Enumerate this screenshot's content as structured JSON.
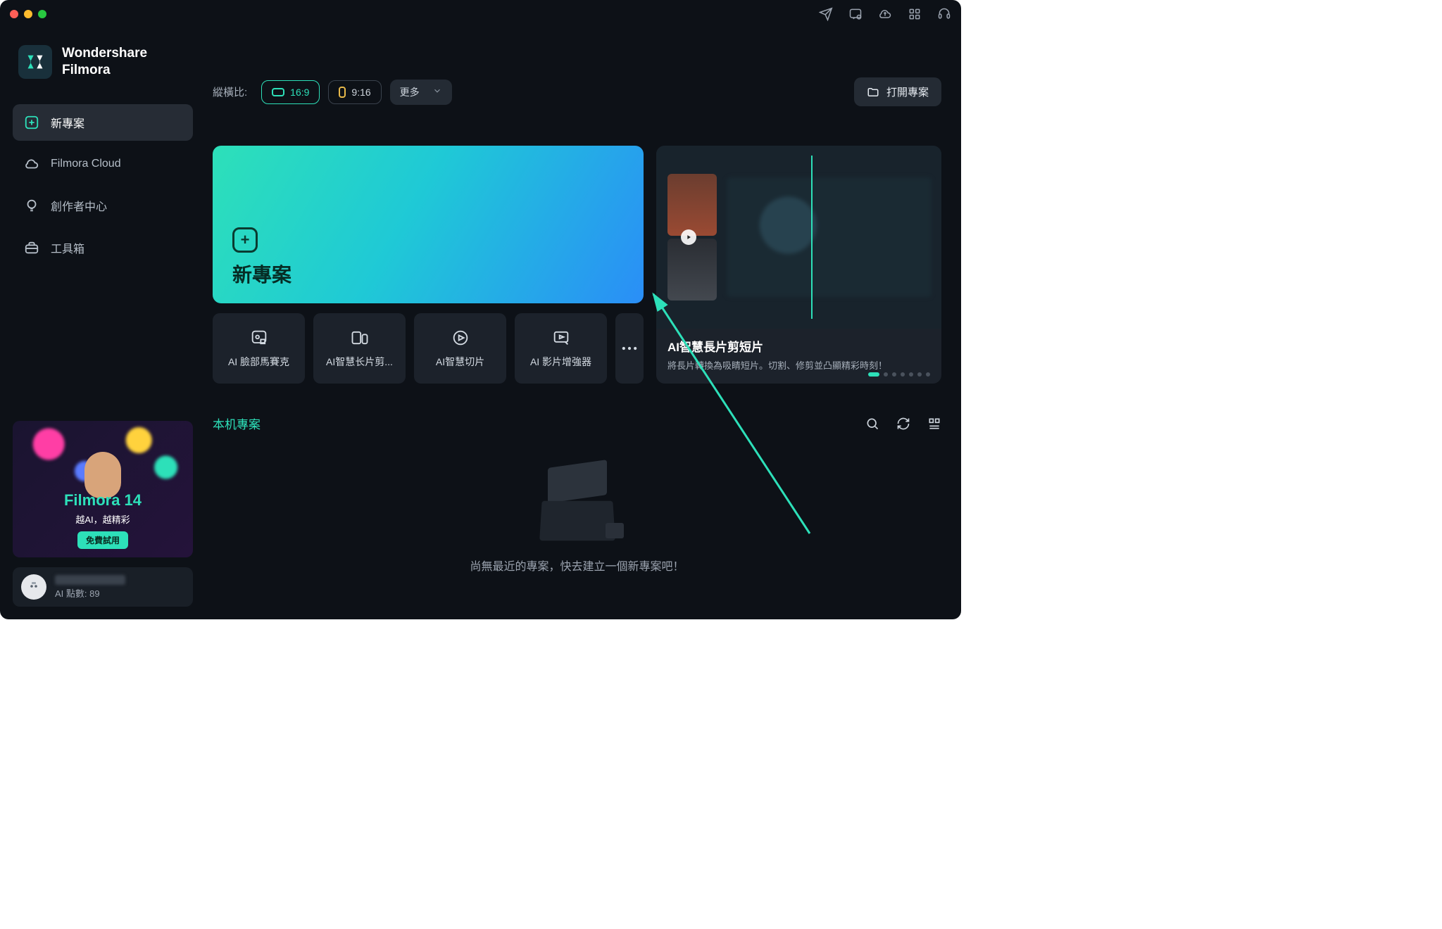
{
  "brand": {
    "line1": "Wondershare",
    "line2": "Filmora"
  },
  "sidebar": {
    "items": [
      {
        "label": "新專案"
      },
      {
        "label": "Filmora Cloud"
      },
      {
        "label": "創作者中心"
      },
      {
        "label": "工具箱"
      }
    ]
  },
  "promo_sidebar": {
    "title": "Filmora 14",
    "subtitle": "越AI，越精彩",
    "button": "免費試用"
  },
  "user": {
    "points": "AI 點數: 89"
  },
  "aspect": {
    "label": "縱橫比:",
    "opt1": "16:9",
    "opt2": "9:16",
    "more": "更多"
  },
  "open_project": "打開專案",
  "new_project": "新專案",
  "tiles": [
    {
      "label": "AI 臉部馬賽克"
    },
    {
      "label": "AI智慧长片剪..."
    },
    {
      "label": "AI智慧切片"
    },
    {
      "label": "AI 影片增強器"
    }
  ],
  "feature_card": {
    "title": "AI智慧長片剪短片",
    "desc": "將長片轉換為吸睛短片。切割、修剪並凸顯精彩時刻！"
  },
  "local_projects": "本机專案",
  "empty_text": "尚無最近的專案，快去建立一個新專案吧！"
}
